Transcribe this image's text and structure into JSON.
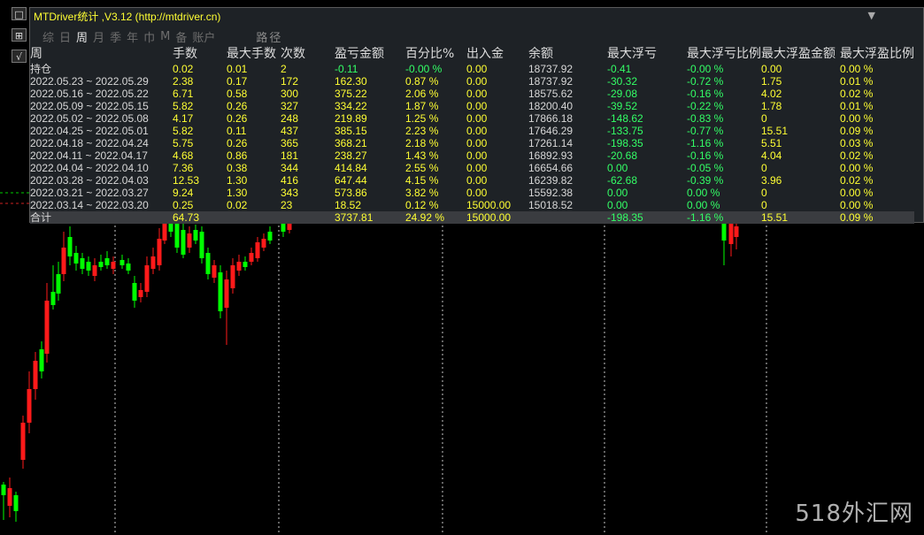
{
  "window": {
    "title": "MTDriver统计 ,V3.12 (http://mtdriver.cn)",
    "collapse_icon": "▼"
  },
  "left_toolbar": [
    {
      "label": "□",
      "icon": "window-icon"
    },
    {
      "label": "⊞",
      "icon": "grid-icon"
    },
    {
      "label": "√",
      "icon": "check-icon"
    }
  ],
  "tabs": {
    "items": [
      "综",
      "日",
      "周",
      "月",
      "季",
      "年",
      "巾",
      "M",
      "备",
      "账户"
    ],
    "active": "周",
    "path_label": "路径"
  },
  "table": {
    "headers": [
      "周",
      "手数",
      "最大手数",
      "次数",
      "盈亏金额",
      "百分比%",
      "出入金",
      "余额",
      "最大浮亏",
      "最大浮亏比例",
      "最大浮盈金额",
      "最大浮盈比例"
    ],
    "rows": [
      [
        "持仓",
        "0.02",
        "0.01",
        "2",
        "-0.11",
        "-0.00 %",
        "0.00",
        "18737.92",
        "-0.41",
        "-0.00 %",
        "0.00",
        "0.00 %"
      ],
      [
        "2022.05.23 ~ 2022.05.29",
        "2.38",
        "0.17",
        "172",
        "162.30",
        "0.87 %",
        "0.00",
        "18737.92",
        "-30.32",
        "-0.72 %",
        "1.75",
        "0.01 %"
      ],
      [
        "2022.05.16 ~ 2022.05.22",
        "6.71",
        "0.58",
        "300",
        "375.22",
        "2.06 %",
        "0.00",
        "18575.62",
        "-29.08",
        "-0.16 %",
        "4.02",
        "0.02 %"
      ],
      [
        "2022.05.09 ~ 2022.05.15",
        "5.82",
        "0.26",
        "327",
        "334.22",
        "1.87 %",
        "0.00",
        "18200.40",
        "-39.52",
        "-0.22 %",
        "1.78",
        "0.01 %"
      ],
      [
        "2022.05.02 ~ 2022.05.08",
        "4.17",
        "0.26",
        "248",
        "219.89",
        "1.25 %",
        "0.00",
        "17866.18",
        "-148.62",
        "-0.83 %",
        "0",
        "0.00 %"
      ],
      [
        "2022.04.25 ~ 2022.05.01",
        "5.82",
        "0.11",
        "437",
        "385.15",
        "2.23 %",
        "0.00",
        "17646.29",
        "-133.75",
        "-0.77 %",
        "15.51",
        "0.09 %"
      ],
      [
        "2022.04.18 ~ 2022.04.24",
        "5.75",
        "0.26",
        "365",
        "368.21",
        "2.18 %",
        "0.00",
        "17261.14",
        "-198.35",
        "-1.16 %",
        "5.51",
        "0.03 %"
      ],
      [
        "2022.04.11 ~ 2022.04.17",
        "4.68",
        "0.86",
        "181",
        "238.27",
        "1.43 %",
        "0.00",
        "16892.93",
        "-20.68",
        "-0.16 %",
        "4.04",
        "0.02 %"
      ],
      [
        "2022.04.04 ~ 2022.04.10",
        "7.36",
        "0.38",
        "344",
        "414.84",
        "2.55 %",
        "0.00",
        "16654.66",
        "0.00",
        "-0.05 %",
        "0",
        "0.00 %"
      ],
      [
        "2022.03.28 ~ 2022.04.03",
        "12.53",
        "1.30",
        "416",
        "647.44",
        "4.15 %",
        "0.00",
        "16239.82",
        "-62.68",
        "-0.39 %",
        "3.96",
        "0.02 %"
      ],
      [
        "2022.03.21 ~ 2022.03.27",
        "9.24",
        "1.30",
        "343",
        "573.86",
        "3.82 %",
        "0.00",
        "15592.38",
        "0.00",
        "0.00 %",
        "0",
        "0.00 %"
      ],
      [
        "2022.03.14 ~ 2022.03.20",
        "0.25",
        "0.02",
        "23",
        "18.52",
        "0.12 %",
        "15000.00",
        "15018.52",
        "0.00",
        "0.00 %",
        "0",
        "0.00 %"
      ]
    ],
    "total": [
      "合计",
      "64.73",
      "",
      "",
      "3737.81",
      "24.92 %",
      "15000.00",
      "",
      "-198.35",
      "-1.16 %",
      "15.51",
      "0.09 %"
    ]
  },
  "watermark": "518外汇网",
  "colors": {
    "up_candle": "#00ff00",
    "down_candle": "#ff1a1a",
    "value_yellow": "#ffff33",
    "value_green": "#33ff66",
    "panel_bg": "#1e2226"
  }
}
